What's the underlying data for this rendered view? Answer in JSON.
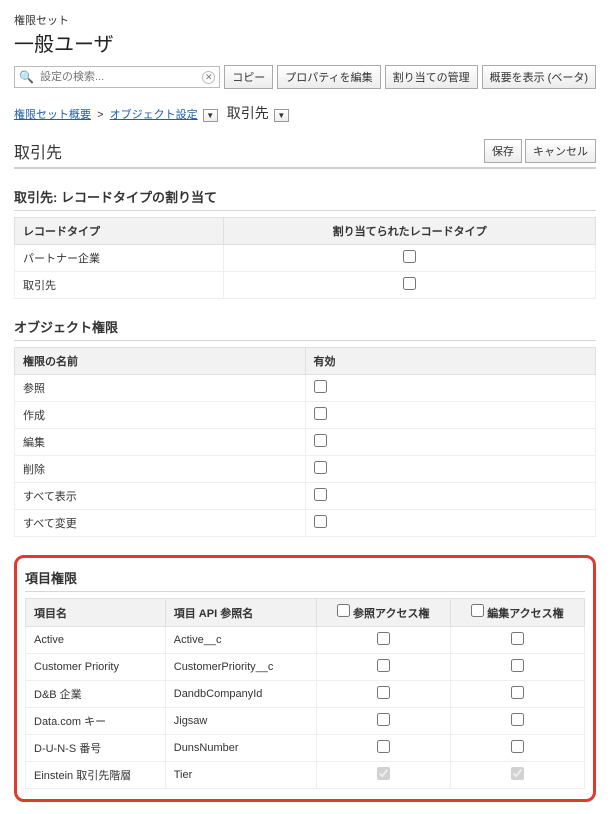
{
  "header": {
    "subtitle": "権限セット",
    "title": "一般ユーザ"
  },
  "toolbar": {
    "search_placeholder": "設定の検索...",
    "clone": "コピー",
    "edit_properties": "プロパティを編集",
    "manage_assignments": "割り当ての管理",
    "view_summary": "概要を表示 (ベータ)"
  },
  "breadcrumb": {
    "overview": "権限セット概要",
    "object_settings": "オブジェクト設定",
    "current": "取引先"
  },
  "page": {
    "heading": "取引先",
    "save": "保存",
    "cancel": "キャンセル"
  },
  "record_types": {
    "title": "取引先: レコードタイプの割り当て",
    "col_record_type": "レコードタイプ",
    "col_assigned": "割り当てられたレコードタイプ",
    "rows": [
      {
        "label": "パートナー企業"
      },
      {
        "label": "取引先"
      }
    ]
  },
  "object_perms": {
    "title": "オブジェクト権限",
    "col_name": "権限の名前",
    "col_enabled": "有効",
    "rows": [
      {
        "label": "参照"
      },
      {
        "label": "作成"
      },
      {
        "label": "編集"
      },
      {
        "label": "削除"
      },
      {
        "label": "すべて表示"
      },
      {
        "label": "すべて変更"
      }
    ]
  },
  "field_perms": {
    "title": "項目権限",
    "col_field": "項目名",
    "col_api": "項目 API 参照名",
    "col_read": "参照アクセス権",
    "col_edit": "編集アクセス権",
    "rows": [
      {
        "field": "Active",
        "api": "Active__c",
        "read": false,
        "edit": false,
        "locked": false
      },
      {
        "field": "Customer Priority",
        "api": "CustomerPriority__c",
        "read": false,
        "edit": false,
        "locked": false
      },
      {
        "field": "D&B 企業",
        "api": "DandbCompanyId",
        "read": false,
        "edit": false,
        "locked": false
      },
      {
        "field": "Data.com キー",
        "api": "Jigsaw",
        "read": false,
        "edit": false,
        "locked": false
      },
      {
        "field": "D-U-N-S 番号",
        "api": "DunsNumber",
        "read": false,
        "edit": false,
        "locked": false
      },
      {
        "field": "Einstein 取引先階層",
        "api": "Tier",
        "read": true,
        "edit": true,
        "locked": true
      }
    ]
  }
}
